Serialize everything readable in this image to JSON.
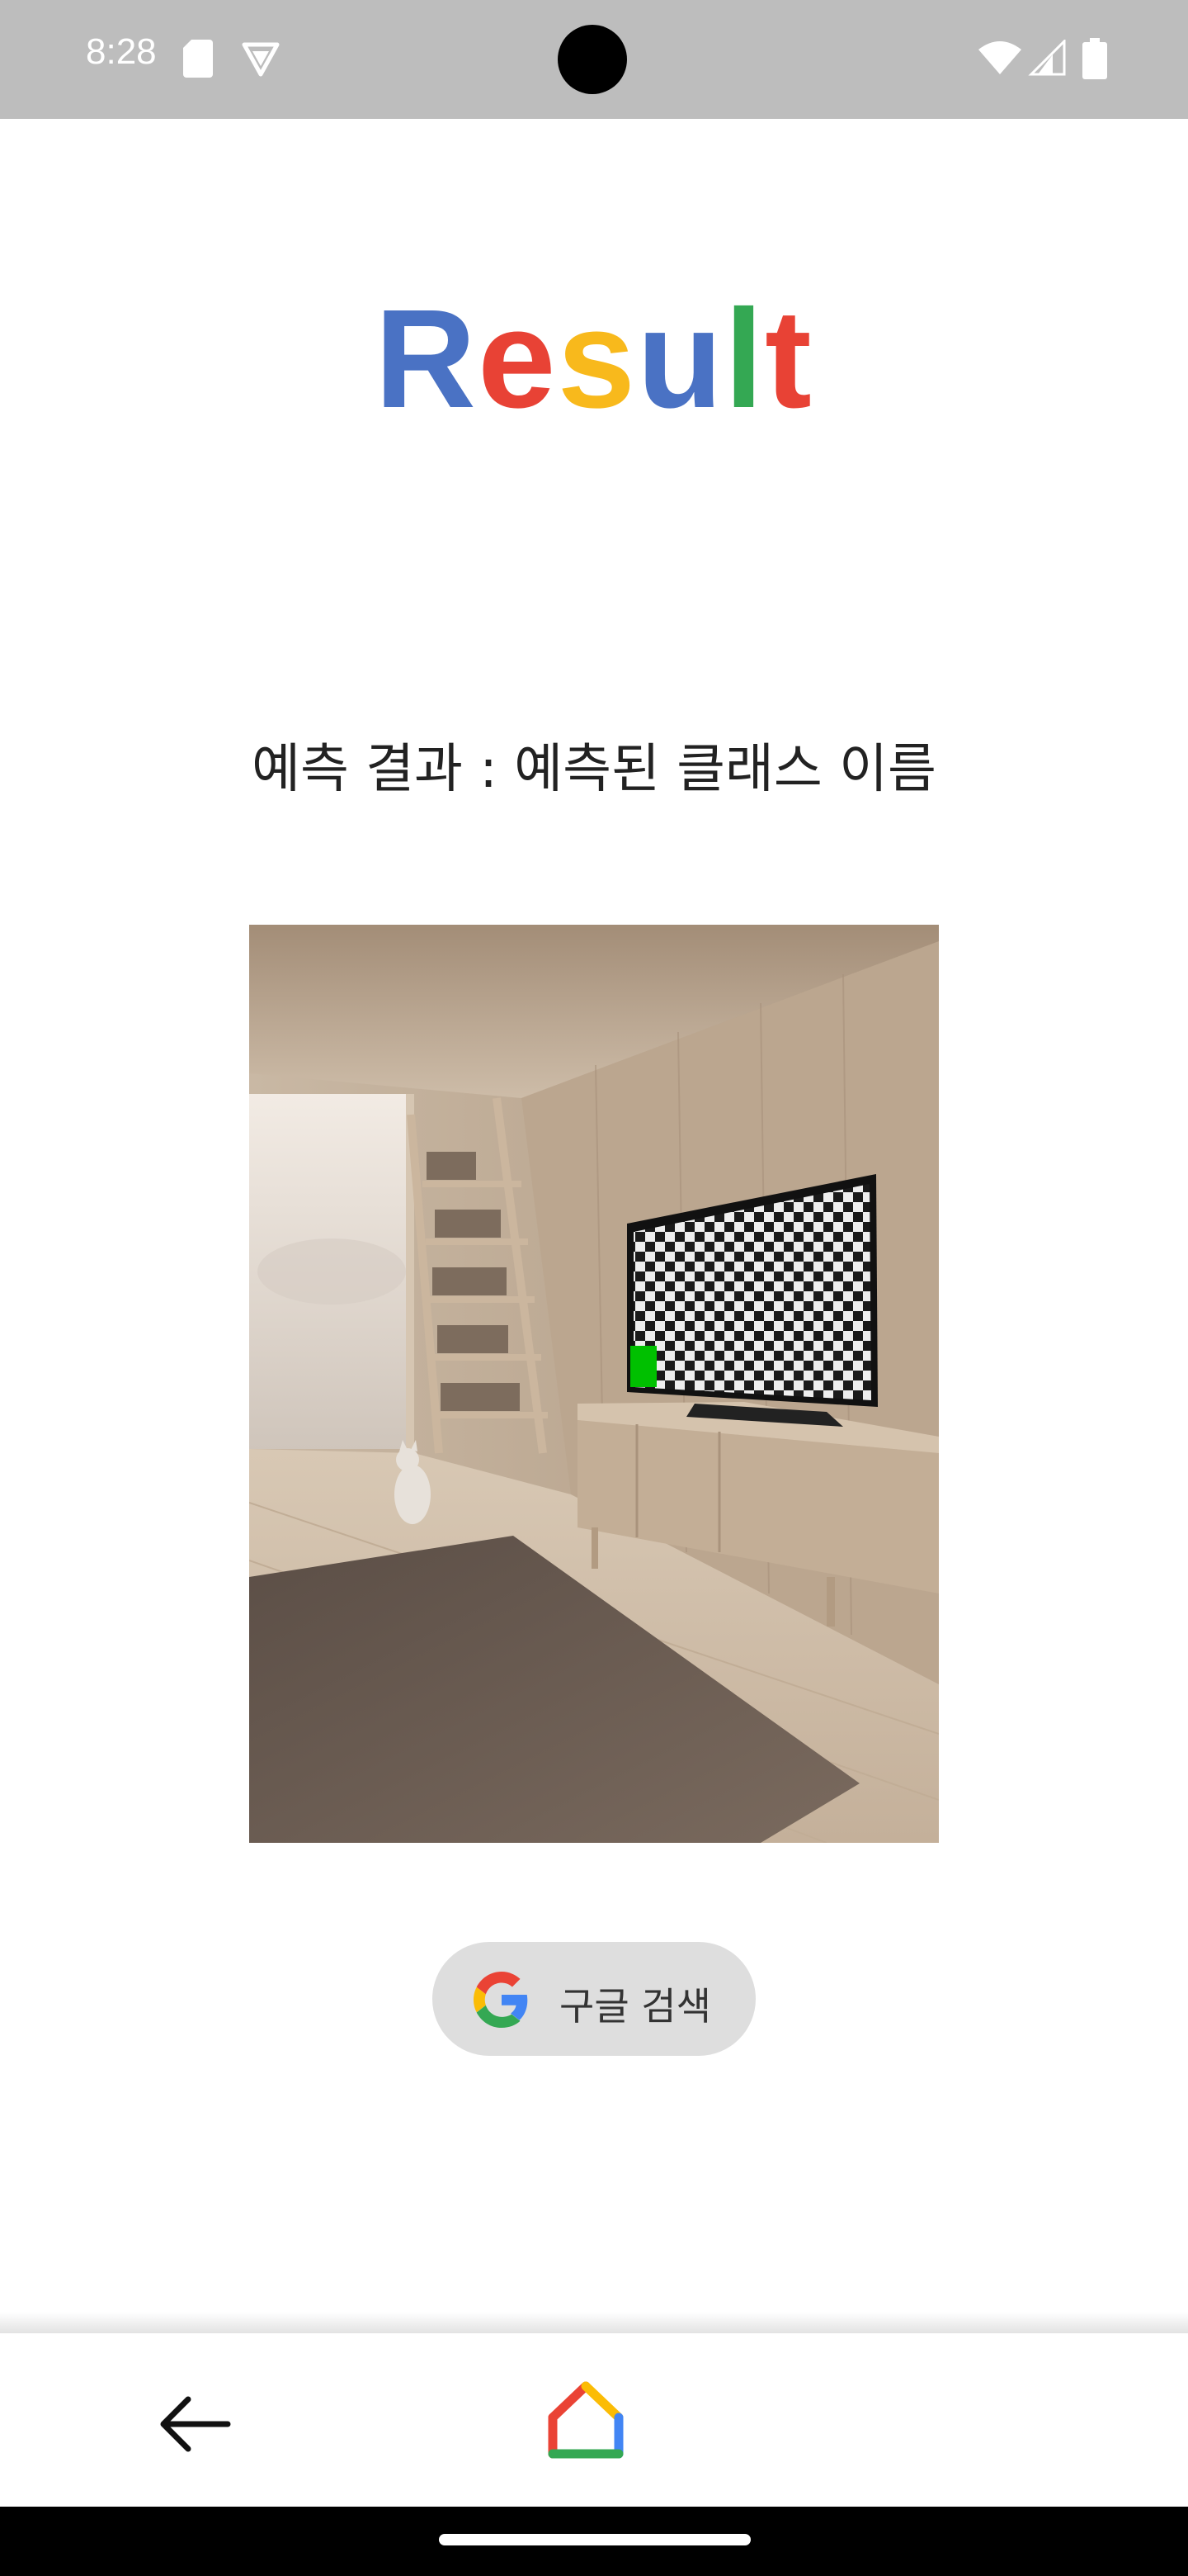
{
  "status_bar": {
    "time": "8:28",
    "icons": [
      "sd-card-icon",
      "vpn-icon",
      "wifi-icon",
      "signal-icon",
      "battery-icon"
    ]
  },
  "title": {
    "letters": [
      {
        "char": "R",
        "color": "#4a72c4"
      },
      {
        "char": "e",
        "color": "#e84235"
      },
      {
        "char": "s",
        "color": "#f8b91c"
      },
      {
        "char": "u",
        "color": "#4a72c4"
      },
      {
        "char": "l",
        "color": "#34a853"
      },
      {
        "char": "t",
        "color": "#e84235"
      }
    ]
  },
  "prediction_text": "예측 결과 : 예측된 클래스 이름",
  "photo": {
    "description_icon": "room-photo-image"
  },
  "google_button": {
    "label": "구글 검색",
    "icon": "google-g-icon"
  },
  "bottom_toolbar": {
    "back_icon": "arrow-left-icon",
    "home_icon": "google-home-icon"
  }
}
